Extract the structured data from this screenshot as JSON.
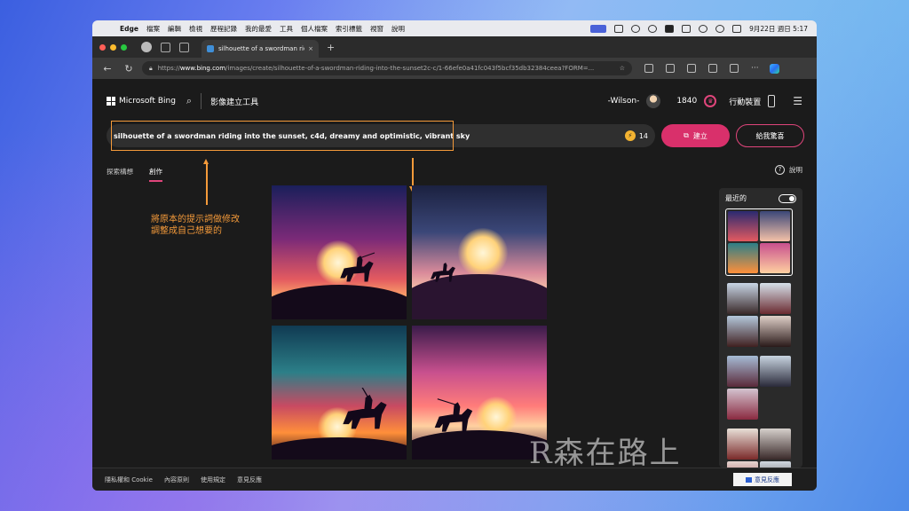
{
  "menubar": {
    "app": "Edge",
    "items": [
      "檔案",
      "編輯",
      "檢視",
      "歷程記錄",
      "我的最愛",
      "工具",
      "個人檔案",
      "索引標籤",
      "視窗",
      "說明"
    ],
    "datetime": "9月22日 週日 5:17"
  },
  "browser": {
    "tab_title": "silhouette of a swordman ridin",
    "url_prefix": "https://",
    "url_host": "www.bing.com",
    "url_path": "/images/create/silhouette-of-a-swordman-riding-into-the-sunset2c-c/1-66efe0a41fc043f5bcf35db32384ceea?FORM=..."
  },
  "header": {
    "brand": "Microsoft Bing",
    "title": "影像建立工具",
    "user": "-Wilson-",
    "points": "1840",
    "mobile": "行動裝置"
  },
  "prompt": {
    "text": "silhouette of a swordman riding into the sunset, c4d, dreamy and optimistic, vibrant sky",
    "boosts": "14",
    "create_label": "建立",
    "surprise_label": "給我驚喜"
  },
  "subtabs": {
    "explore": "探索構想",
    "create": "創作",
    "help": "說明"
  },
  "annotation": {
    "line1": "將原本的提示詞做修改",
    "line2": "調整成自己想要的"
  },
  "recent": {
    "title": "最近的"
  },
  "watermark": "R森在路上",
  "footer": {
    "privacy": "隱私權和 Cookie",
    "content_policy": "內容原則",
    "terms": "使用規定",
    "feedback": "意見反應",
    "feedback_button": "意見反應"
  }
}
